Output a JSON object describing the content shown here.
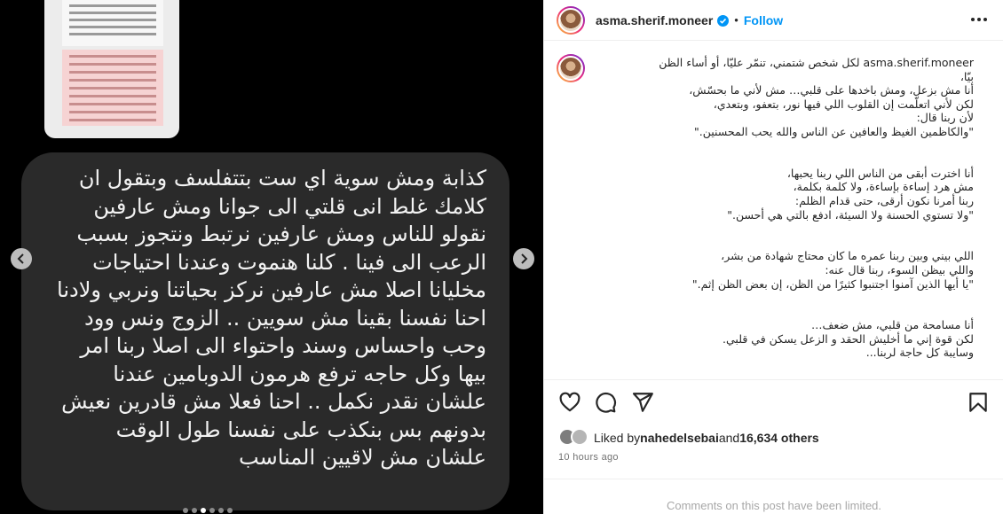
{
  "media": {
    "bubble_text": "كذابة ومش سوية اي ست بتتفلسف وبتقول ان\nكلامك غلط انى قلتي الى جوانا ومش عارفين\nنقولو للناس ومش عارفين نرتبط ونتجوز بسبب\nالرعب الى فينا . كلنا هنموت وعندنا احتياجات\nمخليانا اصلا مش عارفين نركز بحياتنا ونربي ولادنا\nاحنا نفسنا بقينا مش سويين .. الزوج ونس وود\nوحب واحساس وسند واحتواء الى اصلا ربنا امر\nبيها  وكل حاجه ترفع هرمون الدوبامين عندنا\nعلشان نقدر نكمل .. احنا فعلا مش قادرين نعيش\nبدونهم بس بنكذب على نفسنا طول الوقت\nعلشان مش لاقيين المناسب",
    "carousel_dots": 6,
    "active_dot": 2,
    "colors": {
      "bubble": "#2a2a2a",
      "background": "#000000"
    }
  },
  "header": {
    "username": "asma.sherif.moneer",
    "separator": "•",
    "follow_label": "Follow",
    "icons": {
      "verified": "verified-badge-icon",
      "more": "more-options-icon"
    }
  },
  "caption": {
    "username": "asma.sherif.moneer",
    "text": "asma.sherif.moneer لكل شخص شتمني، تنمّر عليّا، أو أساء الظن\nبيّا،\nأنا مش بزعل، ومش باخدها على قلبي… مش لأني ما بحسّش،\nلكن لأني اتعلّمت إن القلوب اللي فيها نور، بتعفو، وبتعدي،\nلأن ربنا قال:\n\"والكاظمين الغيظ والعافين عن الناس والله يحب المحسنين.\"\n\n\nأنا اخترت أبقى من الناس اللي ربنا يحبها،\nمش هرد إساءة بإساءة، ولا كلمة بكلمة،\nربنا أمرنا نكون أرقى، حتى قدام الظلم:\n\"ولا تستوي الحسنة ولا السيئة، ادفع بالتي هي أحسن.\"\n\n\nاللي بيني وبين ربنا عمره ما كان محتاج شهادة من بشر،\nواللي بيظن السوء، ربنا قال عنه:\n\"يا أيها الذين آمنوا اجتنبوا كثيرًا من الظن، إن بعض الظن إثم.\"\n\n\nأنا مسامحة من قلبي، مش ضعف…\nلكن قوة إني ما أخليش الحقد و الزعل يسكن في قلبي.\nوسايبة كل حاجة لربنا..."
  },
  "actions": {
    "icons": [
      "heart-icon",
      "comment-icon",
      "share-icon",
      "save-icon"
    ]
  },
  "likes": {
    "prefix": "Liked by ",
    "user": "nahedelsebai",
    "mid": " and ",
    "count": "16,634 others"
  },
  "timestamp": "10 hours ago",
  "footer_text": "Comments on this post have been limited.",
  "colors": {
    "link": "#0095f6",
    "muted": "#737373",
    "border": "#efefef"
  }
}
